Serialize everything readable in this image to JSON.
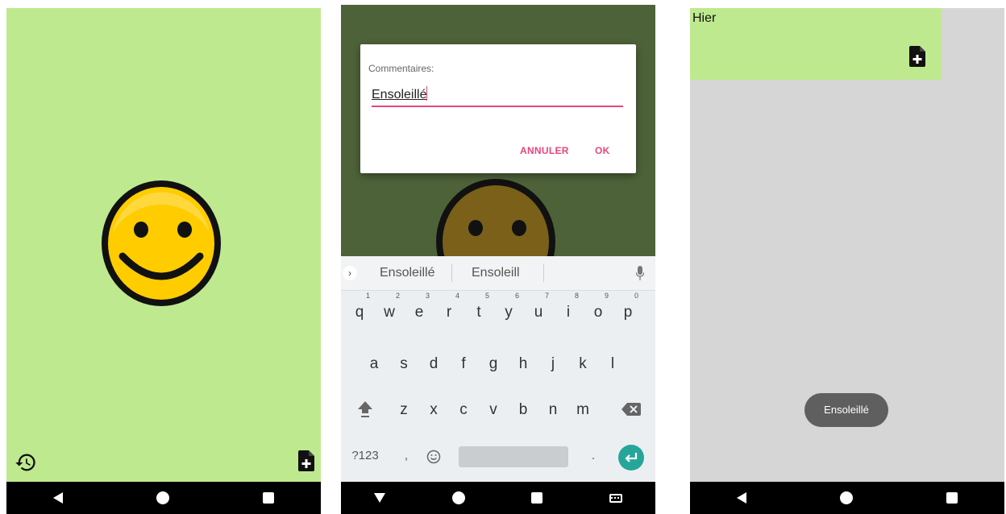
{
  "screen1": {
    "face": "happy-smiley",
    "colors": {
      "background": "#bfe98f",
      "face": "#ffcc00",
      "outline": "#111111"
    }
  },
  "screen2": {
    "dialog": {
      "title": "Commentaires:",
      "input_value": "Ensoleillé",
      "cancel_label": "ANNULER",
      "ok_label": "OK"
    },
    "keyboard": {
      "suggestions": [
        "Ensoleillé",
        "Ensoleill"
      ],
      "row1": [
        {
          "key": "q",
          "hint": "1"
        },
        {
          "key": "w",
          "hint": "2"
        },
        {
          "key": "e",
          "hint": "3"
        },
        {
          "key": "r",
          "hint": "4"
        },
        {
          "key": "t",
          "hint": "5"
        },
        {
          "key": "y",
          "hint": "6"
        },
        {
          "key": "u",
          "hint": "7"
        },
        {
          "key": "i",
          "hint": "8"
        },
        {
          "key": "o",
          "hint": "9"
        },
        {
          "key": "p",
          "hint": "0"
        }
      ],
      "row2": [
        "a",
        "s",
        "d",
        "f",
        "g",
        "h",
        "j",
        "k",
        "l"
      ],
      "row3": [
        "z",
        "x",
        "c",
        "v",
        "b",
        "n",
        "m"
      ],
      "symbols_key": "?123",
      "comma_key": ",",
      "period_key": "."
    }
  },
  "screen3": {
    "history": [
      {
        "date_label": "Hier"
      }
    ],
    "toast": "Ensoleillé",
    "colors": {
      "background": "#d6d6d6",
      "item": "#bfe98f"
    }
  }
}
